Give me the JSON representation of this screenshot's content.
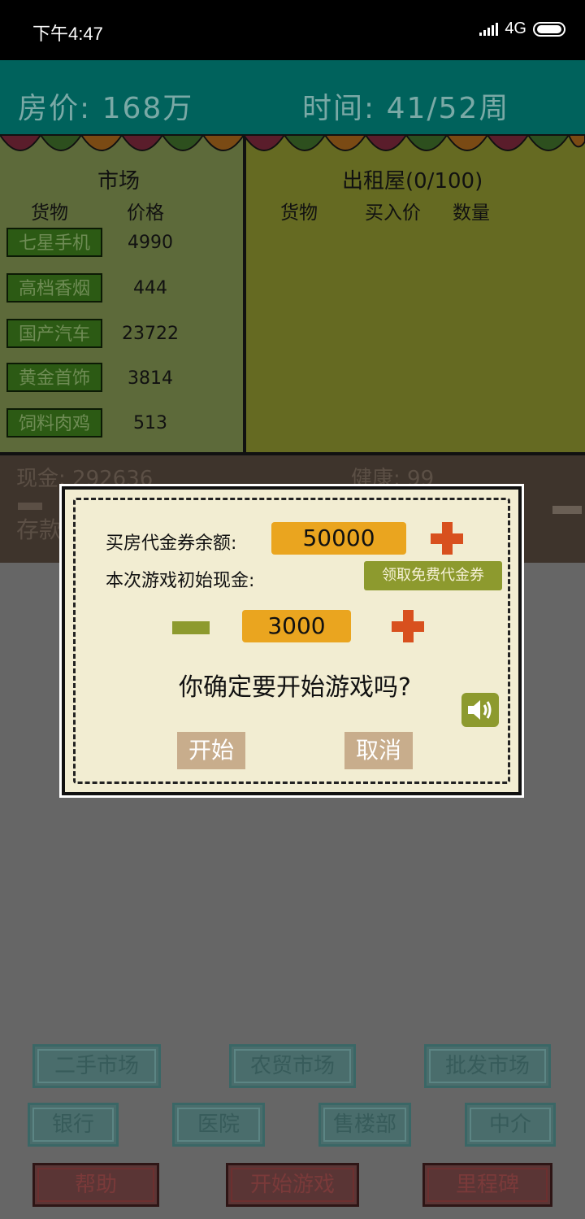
{
  "status_bar": {
    "time": "下午4:47",
    "network": "4G"
  },
  "header": {
    "house_price": "房价: 168万",
    "time": "时间: 41/52周"
  },
  "market": {
    "title": "市场",
    "col_goods": "货物",
    "col_price": "价格",
    "items": [
      {
        "name": "七星手机",
        "price": "4990"
      },
      {
        "name": "高档香烟",
        "price": "444"
      },
      {
        "name": "国产汽车",
        "price": "23722"
      },
      {
        "name": "黄金首饰",
        "price": "3814"
      },
      {
        "name": "饲料肉鸡",
        "price": "513"
      }
    ]
  },
  "rental": {
    "title": "出租屋(0/100)",
    "col_goods": "货物",
    "col_buy_price": "买入价",
    "col_qty": "数量"
  },
  "stats": {
    "cash": "现金: 292636",
    "health": "健康: 99",
    "deposit": "存款"
  },
  "dialog": {
    "voucher_label": "买房代金券余额:",
    "voucher_value": "50000",
    "initial_cash_label": "本次游戏初始现金:",
    "free_voucher_button": "领取免费代金券",
    "initial_cash_value": "3000",
    "question": "你确定要开始游戏吗?",
    "start_button": "开始",
    "cancel_button": "取消"
  },
  "nav": {
    "row1": [
      "二手市场",
      "农贸市场",
      "批发市场"
    ],
    "row2": [
      "银行",
      "医院",
      "售楼部",
      "中介"
    ],
    "row3": [
      "帮助",
      "开始游戏",
      "里程碑"
    ]
  },
  "colors": {
    "header_bg": "#00625c",
    "market_bg": "#5d6a3a",
    "rental_bg": "#656a22",
    "dialog_bg": "#f2edd2",
    "pill": "#eaa51f",
    "plus": "#d8501e",
    "accent_green": "#8d9a2e"
  }
}
